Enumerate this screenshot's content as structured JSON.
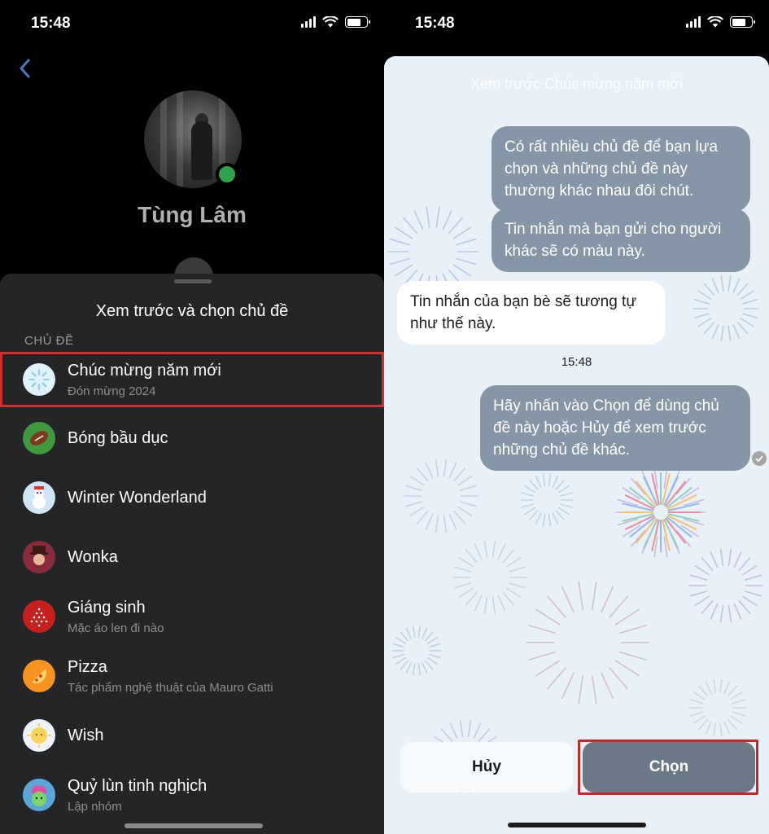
{
  "status": {
    "time": "15:48"
  },
  "left": {
    "profile_name": "Tùng Lâm",
    "sheet_title": "Xem trước và chọn chủ đề",
    "section_label": "CHỦ ĐỀ",
    "themes": [
      {
        "title": "Chúc mừng năm mới",
        "subtitle": "Đón mừng 2024",
        "icon": "fireworks-icon",
        "selected": true
      },
      {
        "title": "Bóng bầu dục",
        "subtitle": "",
        "icon": "football-icon"
      },
      {
        "title": "Winter Wonderland",
        "subtitle": "",
        "icon": "snowman-icon"
      },
      {
        "title": "Wonka",
        "subtitle": "",
        "icon": "wonka-icon"
      },
      {
        "title": "Giáng sinh",
        "subtitle": "Mặc áo len đi nào",
        "icon": "christmas-tree-icon"
      },
      {
        "title": "Pizza",
        "subtitle": "Tác phẩm nghệ thuật của Mauro Gatti",
        "icon": "pizza-icon"
      },
      {
        "title": "Wish",
        "subtitle": "",
        "icon": "star-icon"
      },
      {
        "title": "Quỷ lùn tinh nghịch",
        "subtitle": "Lập nhóm",
        "icon": "trolls-icon"
      }
    ]
  },
  "right": {
    "preview_title": "Xem trước Chúc mừng năm mới",
    "messages": {
      "out1": "Có rất nhiều chủ đề để bạn lựa chọn và những chủ đề này thường khác nhau đôi chút.",
      "out2": "Tin nhắn mà bạn gửi cho người khác sẽ có màu này.",
      "in1": "Tin nhắn của bạn bè sẽ tương tự như thế này.",
      "timestamp": "15:48",
      "out3": "Hãy nhấn vào Chọn để dùng chủ đề này hoặc Hủy để xem trước những chủ đề khác."
    },
    "cancel_label": "Hủy",
    "choose_label": "Chọn"
  },
  "colors": {
    "outgoing_bubble": "#8596a6",
    "highlight_red": "#d32f2f",
    "online_green": "#31a24c"
  }
}
